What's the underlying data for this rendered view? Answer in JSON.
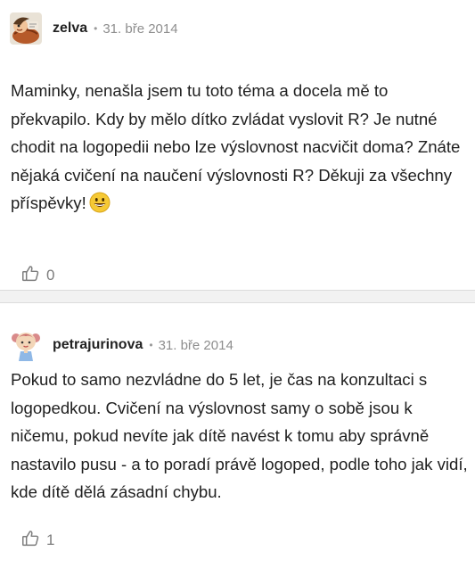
{
  "posts": [
    {
      "author": "zelva",
      "separator": "•",
      "date": "31. bře 2014",
      "text": "Maminky, nenašla jsem tu toto téma a docela mě to překvapilo. Kdy by mělo dítko zvládat vyslovit R? Je nutné chodit na logopedii nebo lze výslovnost nacvičit doma? Znáte nějaká cvičení na naučení výslovnosti R? Děkuji za všechny příspěvky!",
      "emoji": "grinning-face-emoji",
      "likes": "0",
      "avatar_icon": "turtle-avatar-icon"
    },
    {
      "author": "petrajurinova",
      "separator": "•",
      "date": "31. bře 2014",
      "text": "Pokud to samo nezvládne do 5 let, je čas na konzultaci s logopedkou. Cvičení na výslovnost samy o sobě jsou k ničemu, pokud nevíte jak dítě navést k tomu aby správně nastavilo pusu - a to poradí právě logoped, podle toho jak vidí, kde dítě dělá zásadní chybu.",
      "likes": "1",
      "avatar_icon": "girl-avatar-icon"
    }
  ],
  "colors": {
    "text": "#1f1f1f",
    "meta": "#8e8e8e",
    "separator_band": "#f2f2f2",
    "emoji_yellow": "#f6c934"
  },
  "icons": {
    "like": "thumbs-up-icon"
  }
}
